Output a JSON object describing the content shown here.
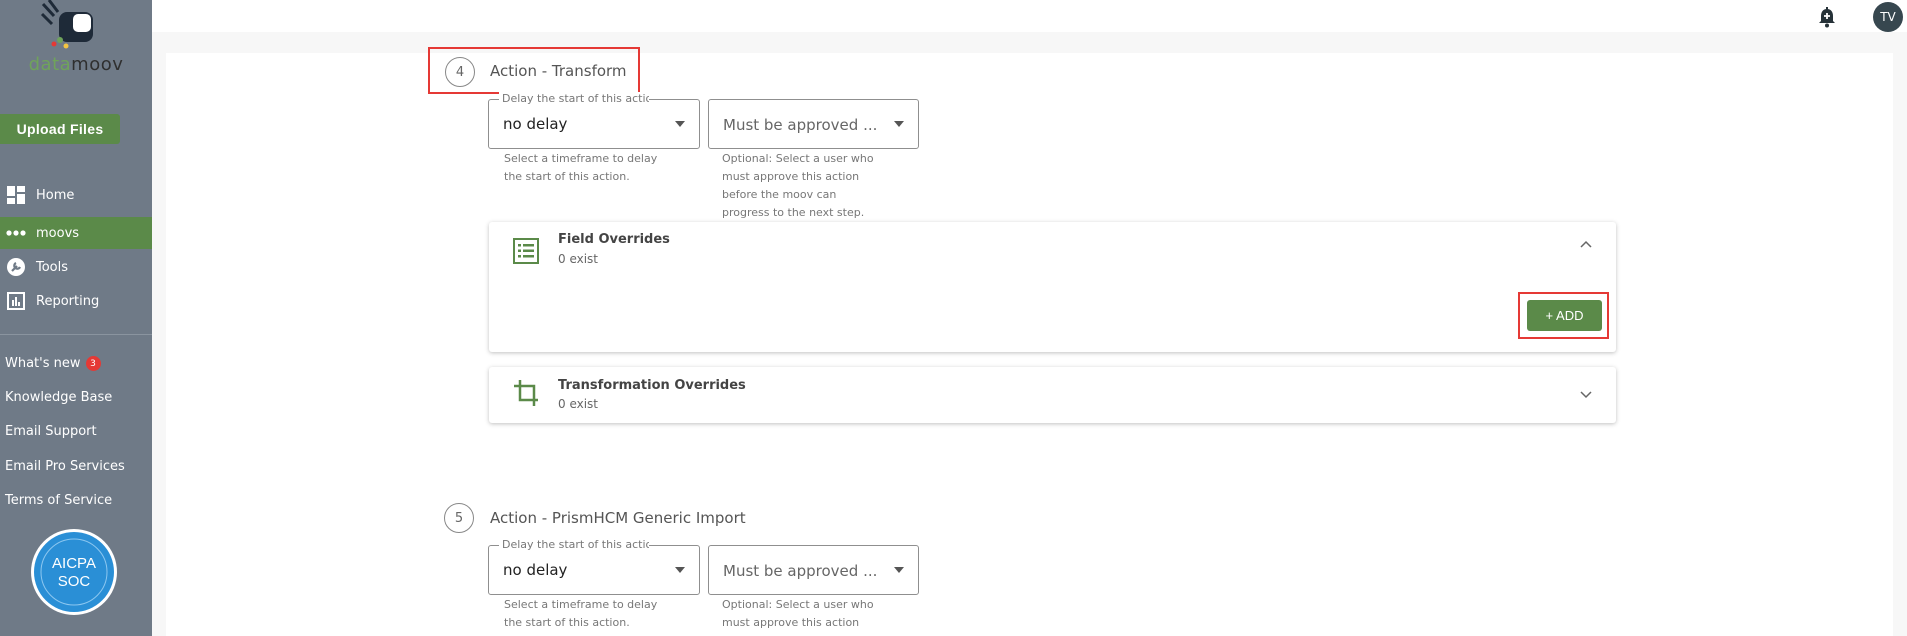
{
  "app": {
    "logo_part1": "data",
    "logo_part2": "moov"
  },
  "sidebar": {
    "upload_label": "Upload Files",
    "nav": [
      {
        "label": "Home",
        "icon": "grid-icon"
      },
      {
        "label": "moovs",
        "icon": "dots-icon",
        "active": true
      },
      {
        "label": "Tools",
        "icon": "wrench-icon"
      },
      {
        "label": "Reporting",
        "icon": "bar-chart-icon"
      }
    ],
    "links": [
      {
        "label": "What's new",
        "badge": "3"
      },
      {
        "label": "Knowledge Base"
      },
      {
        "label": "Email Support"
      },
      {
        "label": "Email Pro Services"
      },
      {
        "label": "Terms of Service"
      }
    ],
    "aicpa": {
      "line1": "AICPA",
      "line2": "SOC"
    }
  },
  "topbar": {
    "avatar_initials": "TV"
  },
  "steps": [
    {
      "number": "4",
      "title": "Action - Transform",
      "delay": {
        "legend": "Delay the start of this action",
        "value": "no delay",
        "helper_1": "Select a timeframe to delay",
        "helper_2": "the start of this action."
      },
      "approval": {
        "placeholder": "Must be approved ...",
        "helper_1": "Optional: Select a user who",
        "helper_2": "must approve this action",
        "helper_3": "before the moov can",
        "helper_4": "progress to the next step."
      },
      "field_overrides": {
        "title": "Field Overrides",
        "count": "0 exist",
        "add_label": "+ ADD"
      },
      "transformation_overrides": {
        "title": "Transformation Overrides",
        "count": "0 exist"
      }
    },
    {
      "number": "5",
      "title": "Action - PrismHCM Generic Import",
      "delay": {
        "legend": "Delay the start of this action",
        "value": "no delay",
        "helper_1": "Select a timeframe to delay",
        "helper_2": "the start of this action."
      },
      "approval": {
        "placeholder": "Must be approved ...",
        "helper_1": "Optional: Select a user who",
        "helper_2": "must approve this action"
      }
    }
  ],
  "colors": {
    "sidebar": "#6f7a87",
    "accent": "#5b8a49",
    "highlight": "#e53935"
  }
}
